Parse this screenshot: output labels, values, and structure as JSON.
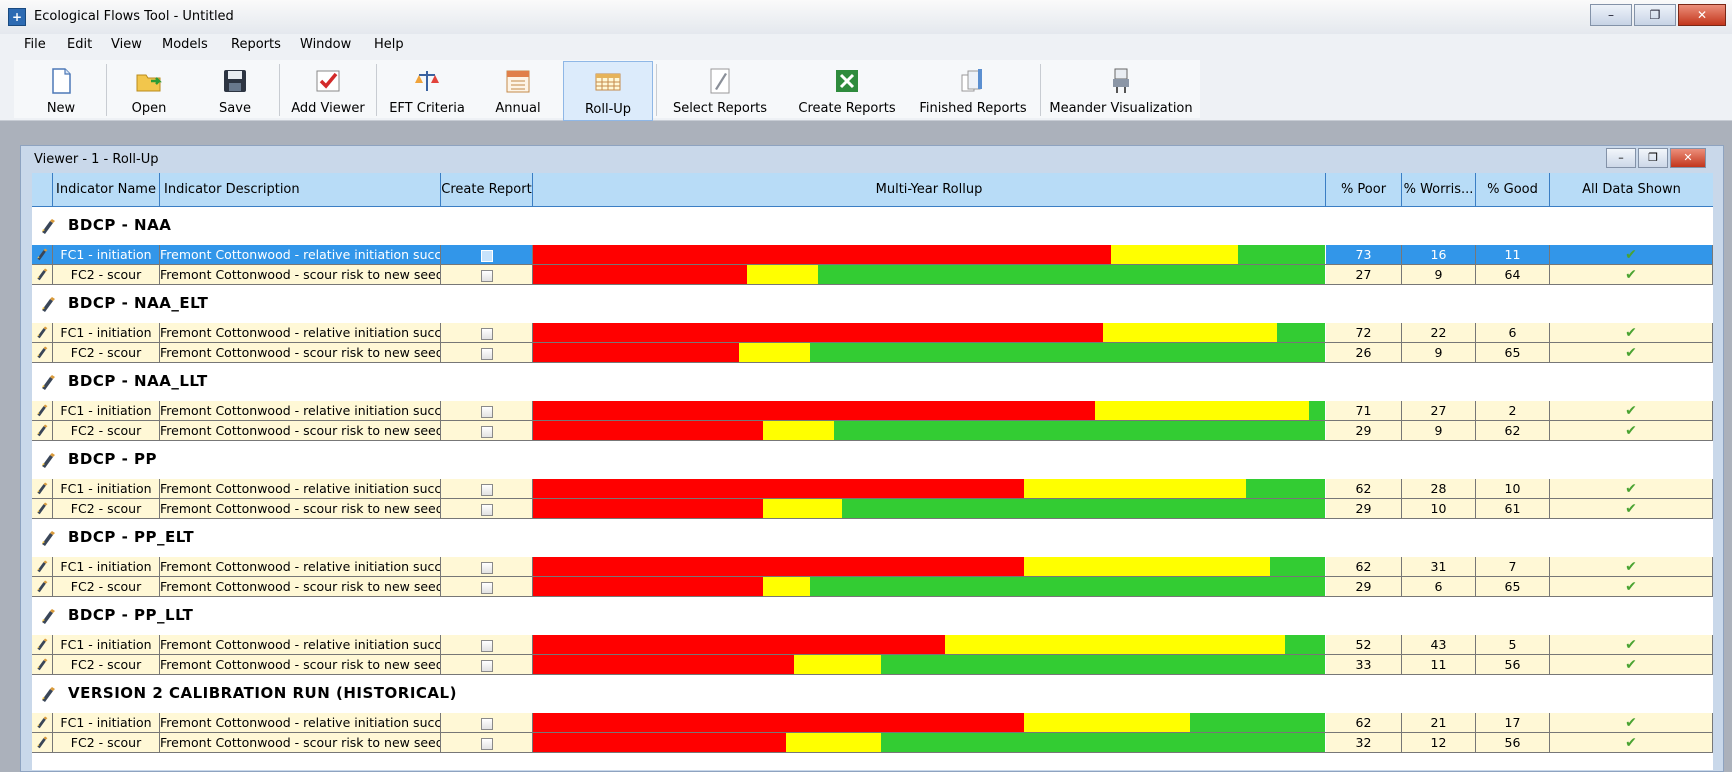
{
  "window": {
    "title": "Ecological Flows Tool - Untitled",
    "controls": [
      "–",
      "❐",
      "✕"
    ]
  },
  "menu": [
    "File",
    "Edit",
    "View",
    "Models",
    "Reports",
    "Window",
    "Help"
  ],
  "toolbar": [
    {
      "label": "New",
      "icon": "new-document-icon"
    },
    {
      "label": "Open",
      "icon": "open-folder-icon"
    },
    {
      "label": "Save",
      "icon": "save-disk-icon"
    },
    {
      "label": "Add Viewer",
      "icon": "add-viewer-icon"
    },
    {
      "label": "EFT Criteria",
      "icon": "balance-scale-icon"
    },
    {
      "label": "Annual",
      "icon": "calendar-icon"
    },
    {
      "label": "Roll-Up",
      "icon": "rollup-grid-icon",
      "active": true
    },
    {
      "label": "Select Reports",
      "icon": "pen-icon"
    },
    {
      "label": "Create Reports",
      "icon": "excel-icon"
    },
    {
      "label": "Finished Reports",
      "icon": "documents-icon"
    },
    {
      "label": "Meander Visualization",
      "icon": "meander-icon"
    }
  ],
  "viewer": {
    "title": "Viewer - 1 - Roll-Up",
    "columns": [
      "Indicator Name",
      "Indicator Description",
      "Create Report",
      "Multi-Year Rollup",
      "% Poor",
      "% Worris...",
      "% Good",
      "All Data Shown"
    ],
    "colors": {
      "poor": "#ff0000",
      "worrisome": "#ffff00",
      "good": "#33cc33"
    },
    "groups": [
      {
        "name": "BDCP - NAA",
        "rows": [
          {
            "name": "FC1 - initiation",
            "desc": "Fremont Cottonwood - relative initiation success",
            "poor": 73,
            "worris": 16,
            "good": 11,
            "selected": true
          },
          {
            "name": "FC2 - scour",
            "desc": "Fremont Cottonwood - scour risk to new seedlings",
            "poor": 27,
            "worris": 9,
            "good": 64
          }
        ]
      },
      {
        "name": "BDCP - NAA_ELT",
        "rows": [
          {
            "name": "FC1 - initiation",
            "desc": "Fremont Cottonwood - relative initiation success",
            "poor": 72,
            "worris": 22,
            "good": 6
          },
          {
            "name": "FC2 - scour",
            "desc": "Fremont Cottonwood - scour risk to new seedlings",
            "poor": 26,
            "worris": 9,
            "good": 65
          }
        ]
      },
      {
        "name": "BDCP - NAA_LLT",
        "rows": [
          {
            "name": "FC1 - initiation",
            "desc": "Fremont Cottonwood - relative initiation success",
            "poor": 71,
            "worris": 27,
            "good": 2
          },
          {
            "name": "FC2 - scour",
            "desc": "Fremont Cottonwood - scour risk to new seedlings",
            "poor": 29,
            "worris": 9,
            "good": 62
          }
        ]
      },
      {
        "name": "BDCP - PP",
        "rows": [
          {
            "name": "FC1 - initiation",
            "desc": "Fremont Cottonwood - relative initiation success",
            "poor": 62,
            "worris": 28,
            "good": 10
          },
          {
            "name": "FC2 - scour",
            "desc": "Fremont Cottonwood - scour risk to new seedlings",
            "poor": 29,
            "worris": 10,
            "good": 61
          }
        ]
      },
      {
        "name": "BDCP - PP_ELT",
        "rows": [
          {
            "name": "FC1 - initiation",
            "desc": "Fremont Cottonwood - relative initiation success",
            "poor": 62,
            "worris": 31,
            "good": 7
          },
          {
            "name": "FC2 - scour",
            "desc": "Fremont Cottonwood - scour risk to new seedlings",
            "poor": 29,
            "worris": 6,
            "good": 65
          }
        ]
      },
      {
        "name": "BDCP - PP_LLT",
        "rows": [
          {
            "name": "FC1 - initiation",
            "desc": "Fremont Cottonwood - relative initiation success",
            "poor": 52,
            "worris": 43,
            "good": 5
          },
          {
            "name": "FC2 - scour",
            "desc": "Fremont Cottonwood - scour risk to new seedlings",
            "poor": 33,
            "worris": 11,
            "good": 56
          }
        ]
      },
      {
        "name": "VERSION 2 CALIBRATION RUN (HISTORICAL)",
        "rows": [
          {
            "name": "FC1 - initiation",
            "desc": "Fremont Cottonwood - relative initiation success",
            "poor": 62,
            "worris": 21,
            "good": 17
          },
          {
            "name": "FC2 - scour",
            "desc": "Fremont Cottonwood - scour risk to new seedlings",
            "poor": 32,
            "worris": 12,
            "good": 56
          }
        ]
      }
    ]
  }
}
